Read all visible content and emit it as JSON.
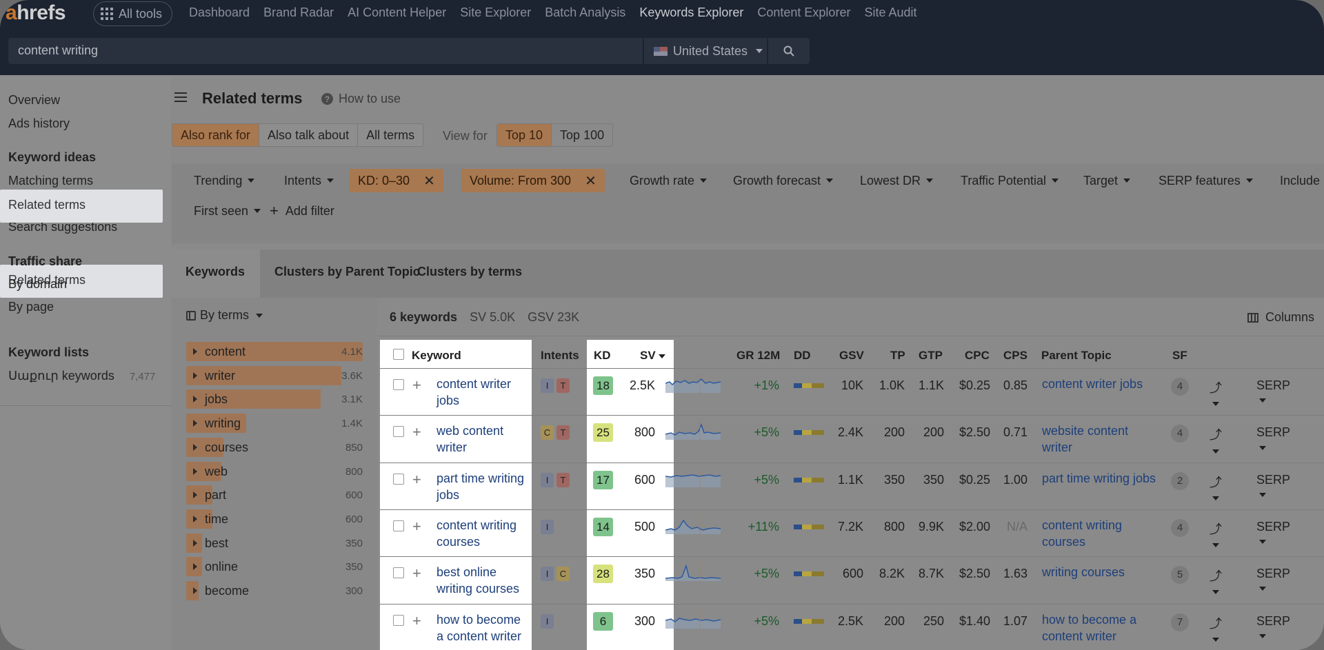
{
  "app": {
    "logo_accent": "a",
    "logo_rest": "hrefs"
  },
  "topbar": {
    "all_tools": "All tools",
    "nav": [
      "Dashboard",
      "Brand Radar",
      "AI Content Helper",
      "Site Explorer",
      "Batch Analysis",
      "Keywords Explorer",
      "Content Explorer",
      "Site Audit"
    ],
    "active_nav": "Keywords Explorer",
    "search_value": "content writing",
    "country": "United States",
    "search_icon": "search-icon"
  },
  "sidebar": {
    "overview": "Overview",
    "ads_history": "Ads history",
    "keyword_ideas": "Keyword ideas",
    "matching_terms": "Matching terms",
    "related_terms": "Related terms",
    "search_suggestions": "Search suggestions",
    "traffic_share": "Traffic share",
    "by_domain": "By domain",
    "by_page": "By page",
    "keyword_lists": "Keyword lists",
    "list_name": "Սաքուր keywords",
    "list_count": "7,477"
  },
  "page": {
    "title": "Related terms",
    "how_to_use": "How to use",
    "modes": [
      "Also rank for",
      "Also talk about",
      "All terms"
    ],
    "active_mode": "Also rank for",
    "view_for": "View for",
    "top_options": [
      "Top 10",
      "Top 100"
    ],
    "active_top": "Top 10"
  },
  "filters": {
    "trending": "Trending",
    "intents": "Intents",
    "kd": "KD: 0–30",
    "volume": "Volume: From 300",
    "growth_rate": "Growth rate",
    "growth_forecast": "Growth forecast",
    "lowest_dr": "Lowest DR",
    "traffic_potential": "Traffic Potential",
    "target": "Target",
    "serp_features": "SERP features",
    "include": "Include",
    "first_seen": "First seen",
    "add_filter": "Add filter"
  },
  "tabs": [
    "Keywords",
    "Clusters by Parent Topic",
    "Clusters by terms"
  ],
  "terms_panel": {
    "by_terms": "By terms",
    "terms": [
      {
        "label": "content",
        "count": "4.1K",
        "fill": 1.0
      },
      {
        "label": "writer",
        "count": "3.6K",
        "fill": 0.88
      },
      {
        "label": "jobs",
        "count": "3.1K",
        "fill": 0.76
      },
      {
        "label": "writing",
        "count": "1.4K",
        "fill": 0.34
      },
      {
        "label": "courses",
        "count": "850",
        "fill": 0.21
      },
      {
        "label": "web",
        "count": "800",
        "fill": 0.2
      },
      {
        "label": "part",
        "count": "600",
        "fill": 0.15
      },
      {
        "label": "time",
        "count": "600",
        "fill": 0.15
      },
      {
        "label": "best",
        "count": "350",
        "fill": 0.09
      },
      {
        "label": "online",
        "count": "350",
        "fill": 0.09
      },
      {
        "label": "become",
        "count": "300",
        "fill": 0.07
      }
    ]
  },
  "table": {
    "summary_count": "6 keywords",
    "summary_sv": "SV 5.0K",
    "summary_gsv": "GSV 23K",
    "columns_btn": "Columns",
    "headers": {
      "keyword": "Keyword",
      "intents": "Intents",
      "kd": "KD",
      "sv": "SV",
      "gr": "GR 12M",
      "dd": "DD",
      "gsv": "GSV",
      "tp": "TP",
      "gtp": "GTP",
      "cpc": "CPC",
      "cps": "CPS",
      "parent": "Parent Topic",
      "sf": "SF"
    },
    "rows": [
      {
        "kw1": "content writer",
        "kw2": "jobs",
        "intents": [
          "I",
          "T"
        ],
        "kd": "18",
        "sv": "2.5K",
        "gr": "+1%",
        "gsv": "10K",
        "tp": "1.0K",
        "gtp": "1.1K",
        "cpc": "$0.25",
        "cps": "0.85",
        "pt1": "content writer jobs",
        "pt2": "",
        "sf": "4",
        "serp": "SERP"
      },
      {
        "kw1": "web content",
        "kw2": "writer",
        "intents": [
          "C",
          "T"
        ],
        "kd": "25",
        "sv": "800",
        "gr": "+5%",
        "gsv": "2.4K",
        "tp": "200",
        "gtp": "200",
        "cpc": "$2.50",
        "cps": "0.71",
        "pt1": "website content",
        "pt2": "writer",
        "sf": "4",
        "serp": "SERP"
      },
      {
        "kw1": "part time writing",
        "kw2": "jobs",
        "intents": [
          "I",
          "T"
        ],
        "kd": "17",
        "sv": "600",
        "gr": "+5%",
        "gsv": "1.1K",
        "tp": "350",
        "gtp": "350",
        "cpc": "$0.25",
        "cps": "1.00",
        "pt1": "part time writing jobs",
        "pt2": "",
        "sf": "2",
        "serp": "SERP"
      },
      {
        "kw1": "content writing",
        "kw2": "courses",
        "intents": [
          "I"
        ],
        "kd": "14",
        "sv": "500",
        "gr": "+11%",
        "gsv": "7.2K",
        "tp": "800",
        "gtp": "9.9K",
        "cpc": "$2.00",
        "cps": "N/A",
        "pt1": "content writing",
        "pt2": "courses",
        "sf": "4",
        "serp": "SERP"
      },
      {
        "kw1": "best online",
        "kw2": "writing courses",
        "intents": [
          "I",
          "C"
        ],
        "kd": "28",
        "sv": "350",
        "gr": "+5%",
        "gsv": "600",
        "tp": "8.2K",
        "gtp": "8.7K",
        "cpc": "$2.50",
        "cps": "1.63",
        "pt1": "writing courses",
        "pt2": "",
        "sf": "5",
        "serp": "SERP"
      },
      {
        "kw1": "how to become",
        "kw2": "a content writer",
        "intents": [
          "I"
        ],
        "kd": "6",
        "sv": "300",
        "gr": "+5%",
        "gsv": "2.5K",
        "tp": "200",
        "gtp": "250",
        "cpc": "$1.40",
        "cps": "1.07",
        "pt1": "how to become a",
        "pt2": "content writer",
        "sf": "7",
        "serp": "SERP"
      }
    ]
  },
  "colors": {
    "accent": "#c8772f",
    "link": "#1d3f7a",
    "kd_green": "#7fc38c",
    "kd_yellow": "#d7e27d"
  }
}
